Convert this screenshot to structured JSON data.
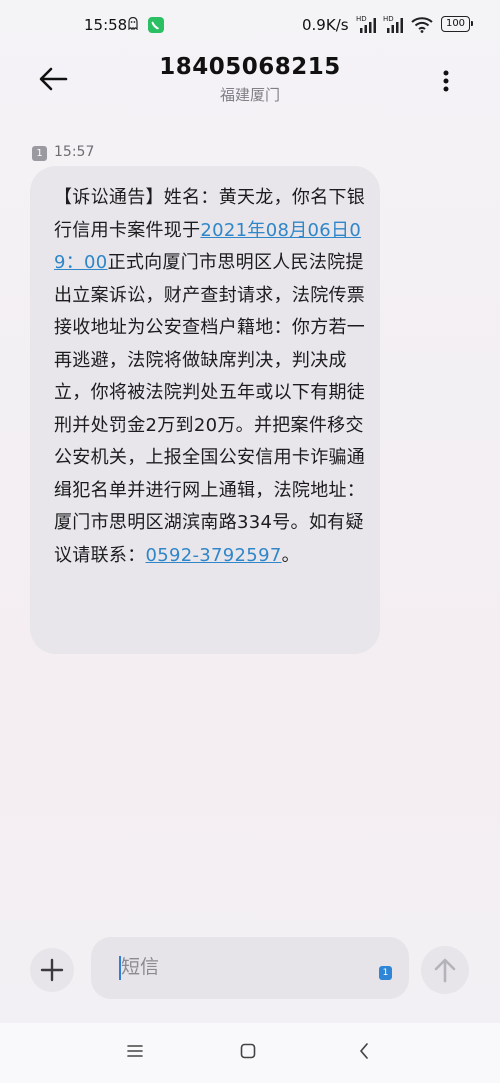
{
  "status_bar": {
    "time": "15:58",
    "net_speed": "0.9K/s",
    "battery": "100",
    "signal_tag": "HD",
    "icons": [
      "ghost-icon",
      "chat-app-icon",
      "signal-icon",
      "wifi-icon",
      "battery-icon"
    ]
  },
  "header": {
    "phone_number": "18405068215",
    "location": "福建厦门",
    "icons": [
      "back-arrow-icon",
      "more-vertical-icon"
    ]
  },
  "message": {
    "sim_slot": "1",
    "time": "15:57",
    "text_1": "【诉讼通告】姓名：黄天龙，你名下银行信用卡案件现于",
    "link_date": "2021年08月06日09：00",
    "text_2": "正式向厦门市思明区人民法院提出立案诉讼，财产查封请求，法院传票接收地址为公安查档户籍地：你方若一再逃避，法院将做缺席判决，判决成立，你将被法院判处五年或以下有期徒刑并处罚金2万到20万。并把案件移交公安机关，上报全国公安信用卡诈骗通缉犯名单并进行网上通辑，法院地址：厦门市思明区湖滨南路334号。如有疑议请联系：",
    "link_phone": "0592-3792597",
    "text_3": "。"
  },
  "compose": {
    "placeholder": "短信",
    "sim_slot": "1",
    "icons": [
      "plus-icon",
      "send-arrow-icon"
    ]
  },
  "nav_bar": {
    "icons": [
      "menu-icon",
      "home-square-icon",
      "back-chevron-icon"
    ]
  },
  "colors": {
    "link": "#2f86c9",
    "bubble": "#e8e6ea",
    "sim_selector": "#2f86d6",
    "chat_app_green": "#2bbf64"
  }
}
